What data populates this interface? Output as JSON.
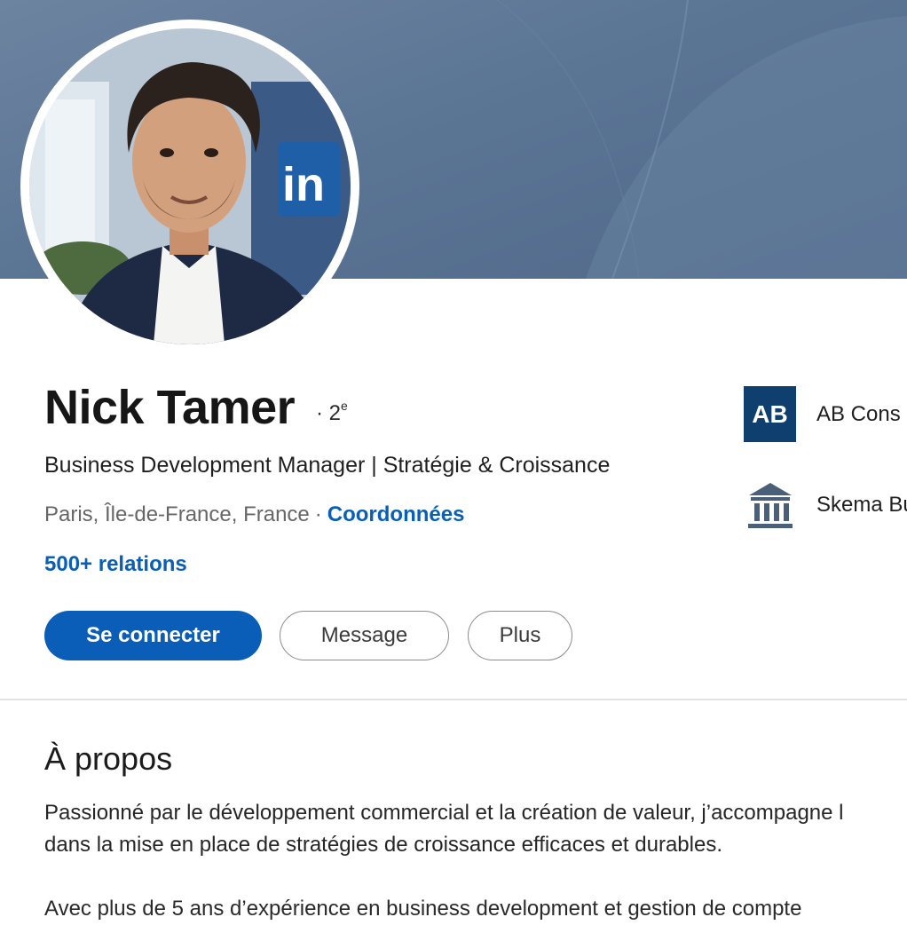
{
  "profile": {
    "name": "Nick Tamer",
    "degree": "· 2",
    "degree_sup": "e",
    "headline": "Business Development Manager | Stratégie & Croissance",
    "location": "Paris, Île-de-France, France",
    "separator": "·",
    "contact_link": "Coordonnées",
    "relations": "500+ relations",
    "banner_logo_text": "in"
  },
  "actions": {
    "connect": "Se connecter",
    "message": "Message",
    "more": "Plus"
  },
  "side": {
    "company_logo_text": "AB",
    "company": "AB Cons",
    "company_icon": "company-logo",
    "school": "Skema Bu",
    "school_icon": "school-building-icon"
  },
  "about": {
    "title": "À propos",
    "line1": "Passionné par le développement commercial et la création de valeur, j’accompagne l",
    "line2": "dans la mise en place de stratégies de croissance efficaces et durables.",
    "line3": "Avec plus de 5 ans d’expérience en business development et gestion de compte"
  },
  "colors": {
    "primary": "#0b5eb8",
    "link": "#0a5fb4",
    "banner": "#5b7595",
    "company_logo_bg": "#0f3f6e"
  }
}
